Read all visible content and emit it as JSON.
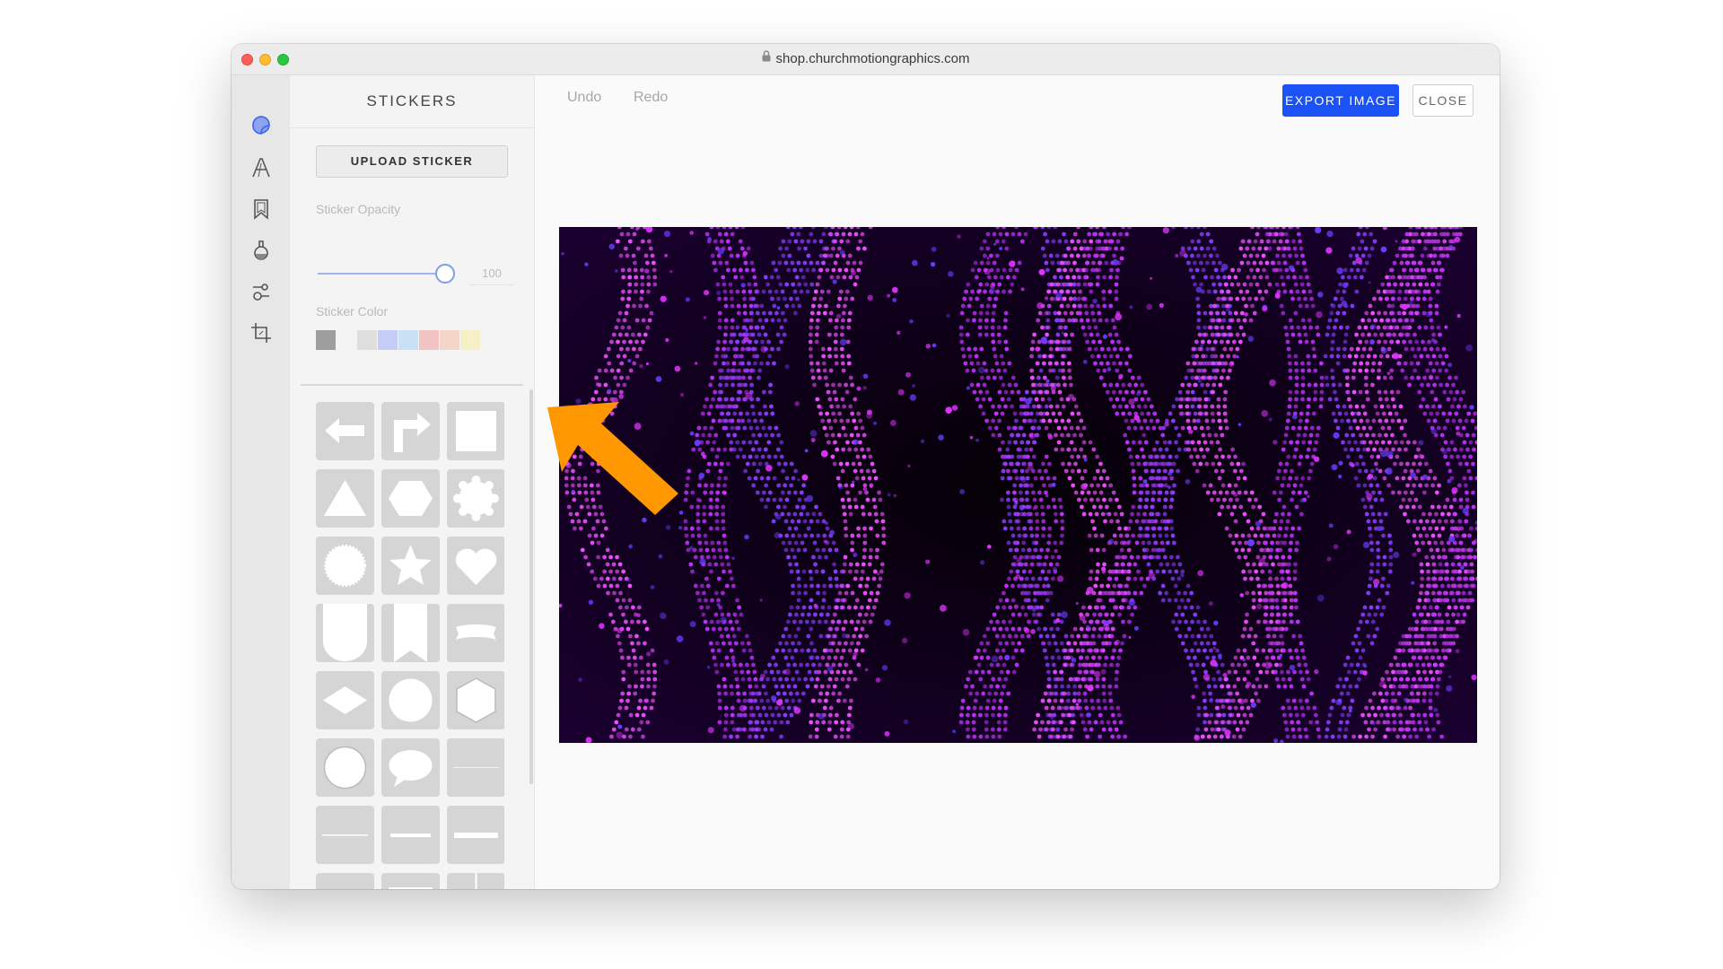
{
  "browser": {
    "url": "shop.churchmotiongraphics.com"
  },
  "icon_bar": {
    "tools": [
      {
        "name": "sticker-tool",
        "icon": "sticker-icon",
        "active": true
      },
      {
        "name": "text-tool",
        "icon": "text-icon"
      },
      {
        "name": "overlay-tool",
        "icon": "bookmark-icon"
      },
      {
        "name": "filter-tool",
        "icon": "flask-icon"
      },
      {
        "name": "adjust-tool",
        "icon": "adjust-icon"
      },
      {
        "name": "crop-tool",
        "icon": "crop-icon"
      }
    ]
  },
  "panel": {
    "title": "STICKERS",
    "upload_label": "UPLOAD STICKER",
    "opacity_label": "Sticker Opacity",
    "opacity_value": "100",
    "opacity_level": 1.0,
    "color_label": "Sticker Color",
    "swatches": [
      "#9e9e9e",
      "#f3f3f3",
      "#dedede",
      "#c3cdf5",
      "#c8e1f4",
      "#f2c3c3",
      "#f4d6c8",
      "#f6f0c6"
    ],
    "stickers": [
      "arrow-left",
      "arrow-turn-right",
      "square",
      "triangle",
      "hexagon",
      "badge-scalloped",
      "seal",
      "star",
      "heart",
      "shield",
      "ribbon-banner",
      "scroll-banner",
      "diamond",
      "circle",
      "hexagon-outline",
      "circle-outline",
      "speech-bubble",
      "thin-line",
      "thin-line-2",
      "medium-line",
      "thick-line",
      "rectangle-bar",
      "rectangle",
      "cross-lines"
    ]
  },
  "toolbar": {
    "undo_label": "Undo",
    "redo_label": "Redo",
    "export_label": "EXPORT IMAGE",
    "close_label": "CLOSE"
  },
  "colors": {
    "accent": "#1a52f5",
    "arrow": "#ff9800",
    "image_glow": "#e033ff"
  }
}
